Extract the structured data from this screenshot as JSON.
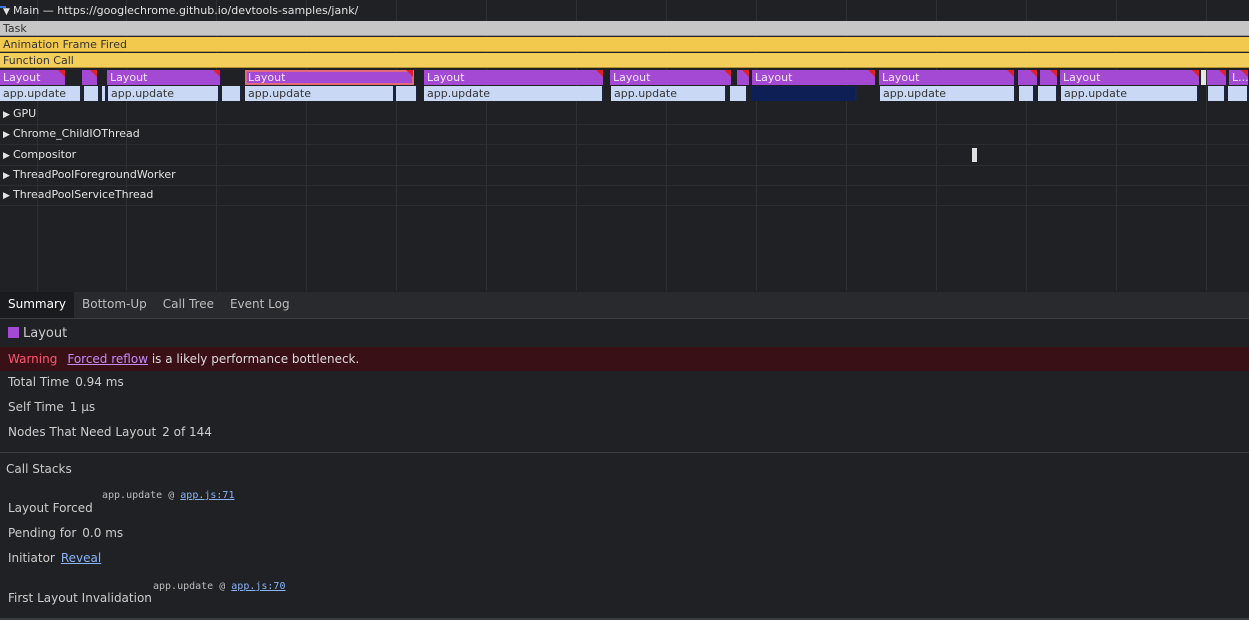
{
  "flame": {
    "main_title": "Main — https://googlechrome.github.io/devtools-samples/jank/",
    "task_label": "Task",
    "anim_label": "Animation Frame Fired",
    "func_label": "Function Call",
    "layout_label": "Layout",
    "layout_short_label": "L...",
    "app_label": "app.update",
    "tracks": [
      "GPU",
      "Chrome_ChildIOThread",
      "Compositor",
      "ThreadPoolForegroundWorker",
      "ThreadPoolServiceThread"
    ]
  },
  "tabs": [
    "Summary",
    "Bottom-Up",
    "Call Tree",
    "Event Log"
  ],
  "summary": {
    "title": "Layout",
    "warning_label": "Warning",
    "warning_link": "Forced reflow",
    "warning_text": " is a likely performance bottleneck.",
    "total_time_label": "Total Time",
    "total_time_value": "0.94 ms",
    "self_time_label": "Self Time",
    "self_time_value": "1 µs",
    "nodes_label": "Nodes That Need Layout",
    "nodes_value": "2 of 144",
    "call_stacks_heading": "Call Stacks",
    "layout_forced_label": "Layout Forced",
    "layout_forced_fn": "app.update @ ",
    "layout_forced_link": "app.js:71",
    "pending_label": "Pending for",
    "pending_value": "0.0 ms",
    "initiator_label": "Initiator",
    "initiator_link": "Reveal",
    "first_invalidation_label": "First Layout Invalidation",
    "first_invalidation_fn": "app.update @ ",
    "first_invalidation_link": "app.js:70"
  },
  "colors": {
    "layout": "#a349d4",
    "app_update": "#c9d9f5",
    "animation_frame": "#f2c94c",
    "task": "#c6c6c6",
    "warning_bg": "#3a1017",
    "warning_label": "#ff5570"
  }
}
